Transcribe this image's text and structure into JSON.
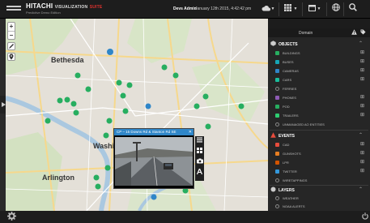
{
  "app": {
    "brand": "HITACHI",
    "brand_vis": "VISUALIZATION",
    "brand_suite": "SUITE",
    "subtitle": "Predictive Demo Edition",
    "user": "Devs Admin",
    "datetime": "January 12th 2015, 4:42:42 pm"
  },
  "toolbar": {
    "icons": [
      "cloud-icon",
      "caret-down-icon",
      "grid-icon",
      "caret-down-icon",
      "window-icon",
      "caret-down-icon",
      "globe-icon",
      "search-icon"
    ]
  },
  "map": {
    "labels": [
      "Bethesda",
      "Washington",
      "Arlington"
    ],
    "zoom_in": "+",
    "zoom_out": "−"
  },
  "popup": {
    "title": "CP – 15 Downs Rd & Stanton Rd SE",
    "close": "✕",
    "icons": [
      "list-icon",
      "grid-icon",
      "camera-icon",
      "text-icon"
    ]
  },
  "panel": {
    "title": "Domain",
    "sections": {
      "objects": {
        "label": "OBJECTS",
        "items": [
          {
            "label": "BUILDINGS",
            "color": "#27ae60"
          },
          {
            "label": "BUSES",
            "color": "#16a6b6"
          },
          {
            "label": "CAMERAS",
            "color": "#2f86c8"
          },
          {
            "label": "CARS",
            "color": "#1abc9c"
          },
          {
            "label": "FERRIES",
            "color": "ring"
          },
          {
            "label": "PHONES",
            "color": "#8e5bb5"
          },
          {
            "label": "POD",
            "color": "#27ae60"
          },
          {
            "label": "TRAILERS",
            "color": "#2ecc71"
          },
          {
            "label": "UNMANAGED AO ENTITIES",
            "color": "ring"
          }
        ]
      },
      "events": {
        "label": "EVENTS",
        "items": [
          {
            "label": "CAD",
            "color": "#e74c3c"
          },
          {
            "label": "GUNSHOTS",
            "color": "#e67e22"
          },
          {
            "label": "LPR",
            "color": "#d35400"
          },
          {
            "label": "TWITTER",
            "color": "#3498db"
          },
          {
            "label": "WIRETAPPINGS",
            "color": "ring"
          }
        ]
      },
      "layers": {
        "label": "LAYERS",
        "items": [
          {
            "label": "WEATHER",
            "color": "ring"
          },
          {
            "label": "NOAA ALERTS",
            "color": "ring"
          }
        ]
      }
    }
  }
}
